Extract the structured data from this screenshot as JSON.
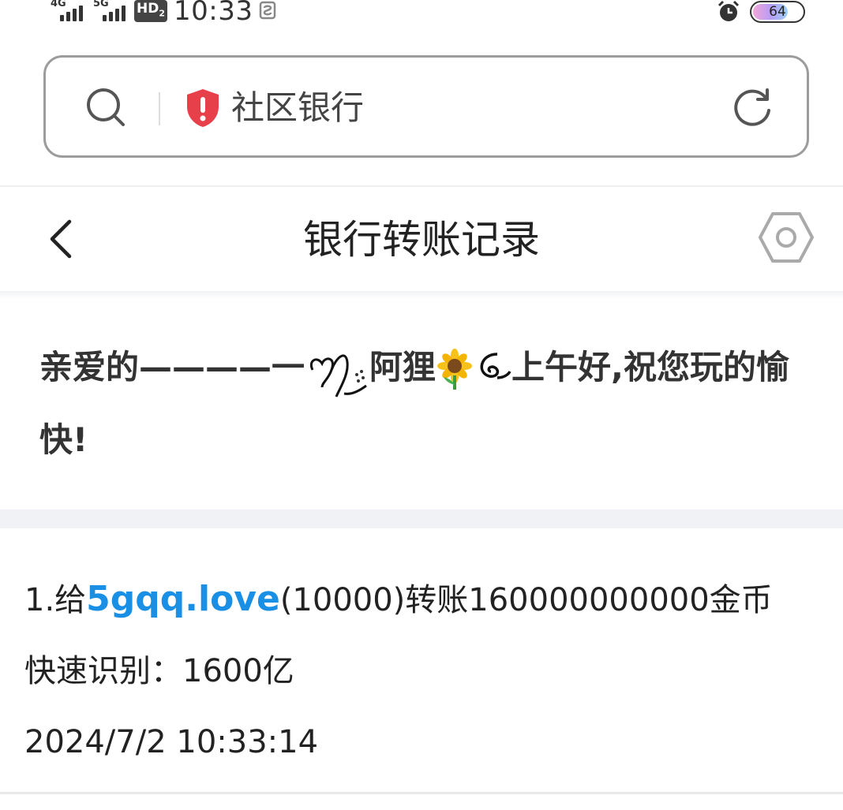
{
  "status_bar": {
    "sim1_type": "4G",
    "sim2_type": "5G",
    "hd_label": "HD",
    "hd_sub": "2",
    "time": "10:33",
    "battery_level": "64"
  },
  "address_bar": {
    "site_name": "社区银行",
    "search_icon": "search-icon",
    "security_icon": "shield-alert-icon",
    "reload_icon": "reload-icon"
  },
  "header": {
    "back_icon": "chevron-left-icon",
    "title": "银行转账记录",
    "settings_icon": "hexagon-settings-icon"
  },
  "greeting": {
    "prefix": "亲爱的————一",
    "name": "阿狸",
    "suffix": "上午好,祝您玩的愉快!"
  },
  "record": {
    "line1_prefix": "1.给",
    "line1_link": "5gqq.love",
    "line1_suffix": "(10000)转账160000000000金币",
    "line2": "快速识别：1600亿",
    "line3": "2024/7/2 10:33:14"
  },
  "colors": {
    "link": "#1a8fe6",
    "shield": "#e8404a",
    "band": "#f1f2f6"
  }
}
